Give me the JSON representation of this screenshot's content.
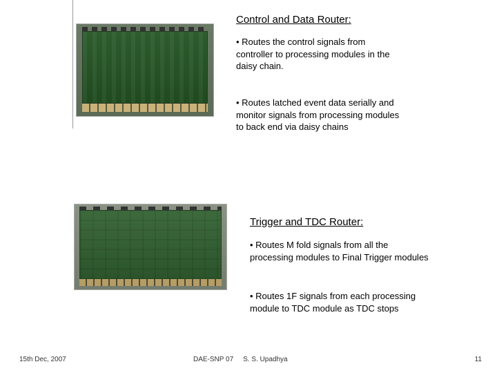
{
  "section1": {
    "title": "Control and Data Router:",
    "bullet1": "• Routes the control signals from controller to processing modules in the daisy chain.",
    "bullet2": "• Routes latched event data serially and monitor signals from processing modules to back end via daisy chains"
  },
  "section2": {
    "title": "Trigger and TDC Router:",
    "bullet1": "• Routes M fold signals from all the processing modules to Final Trigger modules",
    "bullet2": "• Routes 1F signals from each processing module  to TDC module as TDC stops"
  },
  "footer": {
    "left": "15th Dec, 2007",
    "center_conf": "DAE-SNP 07",
    "center_author": "S. S. Upadhya",
    "page": "11"
  }
}
